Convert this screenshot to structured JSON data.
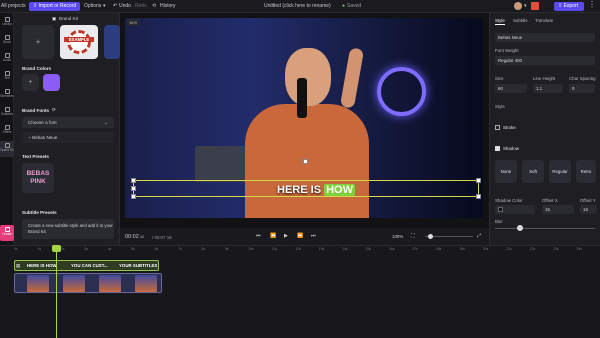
{
  "topbar": {
    "all_projects": "All projects",
    "import_record": "Import or Record",
    "options": "Options",
    "undo": "Undo",
    "redo": "Redo",
    "history": "History",
    "project_title": "Untitled (click here to rename)",
    "saved": "Saved",
    "export": "Export"
  },
  "rail": {
    "items": [
      "Library",
      "Stock",
      "Audio",
      "Text",
      "Elements",
      "Subtitles",
      "Filters",
      "Brand Kit"
    ],
    "create": "Create",
    "bottom": [
      "Split",
      "Cut",
      "Add track"
    ]
  },
  "leftpanel": {
    "title": "Brand Kit",
    "logo_example": "EXAMPLE",
    "brand_colors": "Brand Colors",
    "brand_fonts": "Brand Fonts",
    "choose_font": "Choose a font",
    "font_item": "Bebas Neue",
    "text_presets": "Text Presets",
    "preset_line1": "BEBAS",
    "preset_line2": "PINK",
    "subtitle_presets": "Subtitle Presets",
    "subtitle_hint": "Create a new subtitle style and add it to your Brand Kit"
  },
  "canvas": {
    "tag": "16:9",
    "caption_a": "HERE IS",
    "caption_b": "HOW"
  },
  "playbar": {
    "current_time": "00:02",
    "current_frames": "06",
    "total_time": "00:07",
    "total_frames": "16",
    "zoom": "100%"
  },
  "rightpanel": {
    "tabs": [
      "Style",
      "Subtitle",
      "Translate"
    ],
    "font_value": "Bebas Neue",
    "font_weight_label": "Font Weight",
    "font_weight_value": "Regular 400",
    "size_label": "Size",
    "size_value": "60",
    "line_height_label": "Line Height",
    "line_height_value": "1.1",
    "char_spacing_label": "Char Spacing",
    "char_spacing_value": "0",
    "style_label": "Style",
    "stroke_label": "Stroke",
    "shadow_label": "Shadow",
    "shadow_options": [
      "None",
      "Soft",
      "Regular",
      "Retro"
    ],
    "shadow_color_label": "Shadow Color",
    "offset_x_label": "Offset X",
    "offset_x_value": "15",
    "offset_y_label": "Offset Y",
    "offset_y_value": "15",
    "blur_label": "Blur"
  },
  "timeline": {
    "ruler": [
      "0s",
      "1s",
      "2s",
      "3s",
      "4s",
      "5s",
      "6s",
      "7s",
      "8s",
      "9s",
      "10s",
      "11s",
      "12s",
      "13s",
      "14s",
      "15s",
      "16s",
      "17s",
      "18s",
      "19s",
      "20s",
      "21s",
      "22s",
      "23s",
      "24s"
    ],
    "captions": [
      "HERE IS HOW",
      "YOU CAN CUST...",
      "YOUR SUBTITLES"
    ]
  },
  "colors": {
    "accent": "#5b4af0",
    "caption_highlight": "#7fcf3e",
    "playhead": "#a7d542",
    "brand_color": "#8b5cf6"
  }
}
